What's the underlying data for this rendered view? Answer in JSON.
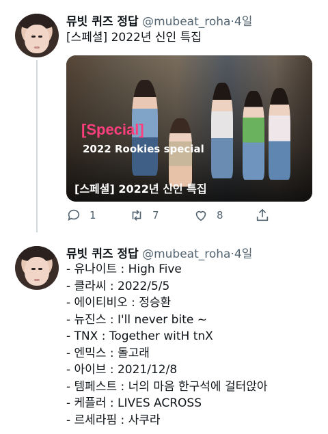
{
  "tweet1": {
    "name": "뮤빗 퀴즈 정답",
    "handle": "@mubeat_roha",
    "separator": "·",
    "time": "4일",
    "text": "[스페셜] 2022년 신인 특집",
    "card": {
      "overlay_title": "[Special]",
      "overlay_subtitle": "2022 Rookies special",
      "caption": "[스페셜] 2022년 신인 특집"
    },
    "actions": {
      "replies": "1",
      "retweets": "7",
      "likes": "8"
    }
  },
  "tweet2": {
    "name": "뮤빗 퀴즈 정답",
    "handle": "@mubeat_roha",
    "separator": "·",
    "time": "4일",
    "lines": [
      "- 유나이트 : High Five",
      "- 클라씨 : 2022/5/5",
      "- 에이티비오 : 정승환",
      "- 뉴진스 : I'll never bite ~",
      "- TNX : Together witH tnX",
      "- 엔믹스 : 돌고래",
      "- 아이브 : 2021/12/8",
      "- 템페스트 : 너의 마음 한구석에 걸터앉아",
      "- 케플러 : LIVES ACROSS",
      "- 르세라핌 : 사쿠라"
    ]
  },
  "colors": {
    "text": "#0f1419",
    "secondary": "#536471",
    "thread_line": "#cfd9de",
    "special_pink": "#ff3e7d"
  }
}
